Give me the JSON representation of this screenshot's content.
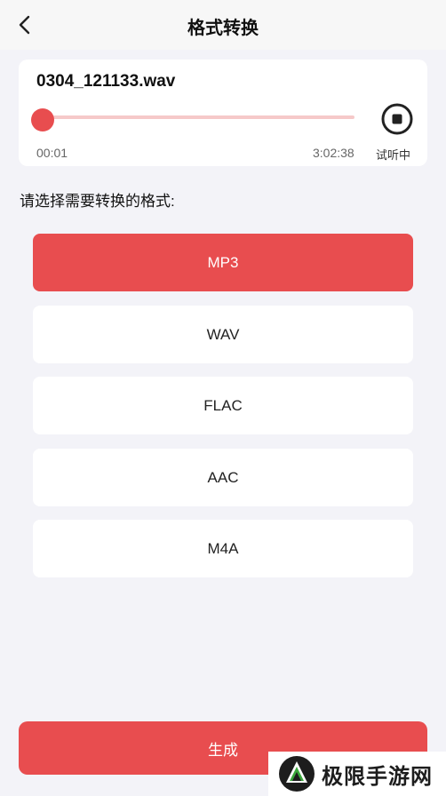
{
  "header": {
    "title": "格式转换",
    "back_icon": "chevron-left-icon"
  },
  "player": {
    "filename": "0304_121133.wav",
    "current_time": "00:01",
    "duration": "3:02:38",
    "progress": 0.0,
    "status_label": "试听中",
    "stop_icon": "stop-circle-icon",
    "accent_color": "#e84d4f",
    "track_color": "#f6c9c9"
  },
  "prompt": "请选择需要转换的格式:",
  "formats": [
    {
      "label": "MP3",
      "selected": true
    },
    {
      "label": "WAV",
      "selected": false
    },
    {
      "label": "FLAC",
      "selected": false
    },
    {
      "label": "AAC",
      "selected": false
    },
    {
      "label": "M4A",
      "selected": false
    }
  ],
  "generate_label": "生成",
  "watermark": {
    "text": "极限手游网"
  }
}
